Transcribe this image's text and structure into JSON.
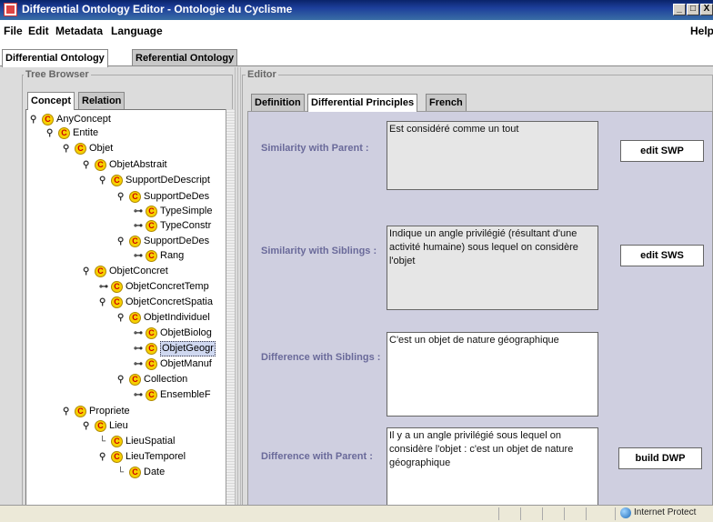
{
  "window": {
    "title": "Differential Ontology Editor - Ontologie du Cyclisme",
    "buttons": [
      "_",
      "□",
      "X"
    ]
  },
  "menubar": {
    "items": [
      "File",
      "Edit",
      "Metadata",
      "Language"
    ],
    "help": "Help"
  },
  "top_tabs": [
    "Differential Ontology",
    "Referential Ontology"
  ],
  "tree_browser": {
    "title": "Tree Browser",
    "tabs": [
      "Concept",
      "Relation"
    ],
    "icon_letter": "C",
    "nodes": [
      {
        "label": "AnyConcept"
      },
      {
        "label": "Entite"
      },
      {
        "label": "Objet"
      },
      {
        "label": "ObjetAbstrait"
      },
      {
        "label": "SupportDeDescript"
      },
      {
        "label": "SupportDeDes"
      },
      {
        "label": "TypeSimple"
      },
      {
        "label": "TypeConstr"
      },
      {
        "label": "SupportDeDes"
      },
      {
        "label": "Rang"
      },
      {
        "label": "ObjetConcret"
      },
      {
        "label": "ObjetConcretTemp"
      },
      {
        "label": "ObjetConcretSpatia"
      },
      {
        "label": "ObjetIndividuel"
      },
      {
        "label": "ObjetBiolog"
      },
      {
        "label": "ObjetGeogr"
      },
      {
        "label": "ObjetManuf"
      },
      {
        "label": "Collection"
      },
      {
        "label": "EnsembleF"
      },
      {
        "label": "Propriete"
      },
      {
        "label": "Lieu"
      },
      {
        "label": "LieuSpatial"
      },
      {
        "label": "LieuTemporel"
      },
      {
        "label": "Date"
      }
    ]
  },
  "editor": {
    "title": "Editor",
    "tabs": [
      "Definition",
      "Differential Principles",
      "French"
    ],
    "rows": [
      {
        "label": "Similarity with Parent :",
        "text": "Est considéré comme un tout",
        "button": "edit SWP"
      },
      {
        "label": "Similarity with Siblings :",
        "text": "Indique un angle privilégié (résultant d'une activité humaine) sous lequel on considère l'objet",
        "button": "edit SWS"
      },
      {
        "label": "Difference with Siblings :",
        "text": "C'est un objet de nature géographique",
        "button": ""
      },
      {
        "label": "Difference with Parent :",
        "text": "Il y a un angle privilégié sous lequel on considère l'objet : c'est un objet de nature géographique",
        "button": "build DWP"
      }
    ]
  },
  "statusbar": {
    "zone": "Internet Protect"
  }
}
